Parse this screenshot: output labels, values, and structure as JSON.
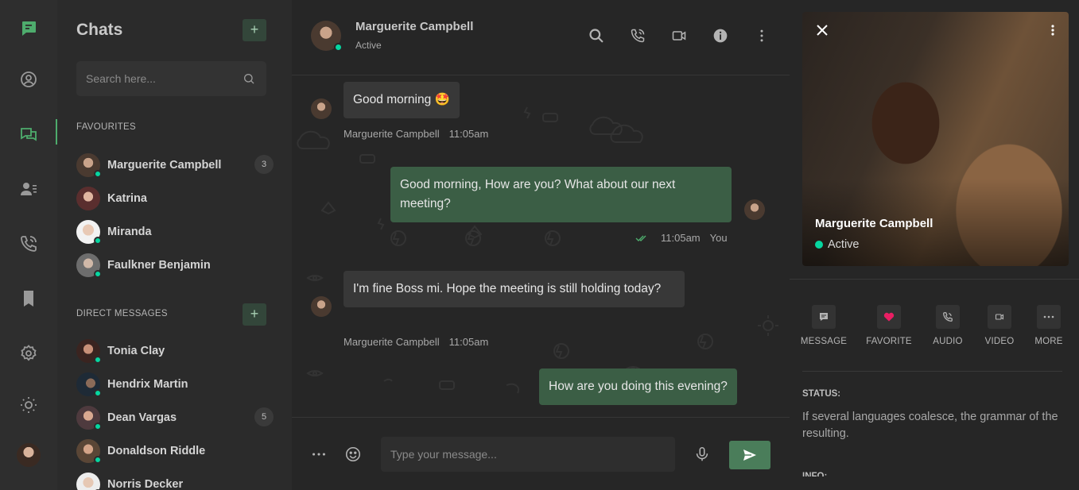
{
  "colors": {
    "accent": "#4eac6d",
    "online": "#06d6a0",
    "favorite": "#e91e63"
  },
  "rail": {
    "items": [
      {
        "name": "logo",
        "icon": "chat-logo-icon"
      },
      {
        "name": "profile",
        "icon": "user-circle-icon"
      },
      {
        "name": "chats",
        "icon": "chats-icon",
        "active": true
      },
      {
        "name": "contacts",
        "icon": "contacts-icon"
      },
      {
        "name": "calls",
        "icon": "phone-call-icon"
      },
      {
        "name": "bookmarks",
        "icon": "bookmark-icon"
      },
      {
        "name": "settings",
        "icon": "gear-icon"
      },
      {
        "name": "theme",
        "icon": "sun-icon"
      }
    ]
  },
  "chatlist": {
    "title": "Chats",
    "search_placeholder": "Search here...",
    "favourites_label": "FAVOURITES",
    "direct_label": "DIRECT MESSAGES",
    "favourites": [
      {
        "name": "Marguerite Campbell",
        "badge": "3",
        "online": true
      },
      {
        "name": "Katrina",
        "online": false
      },
      {
        "name": "Miranda",
        "online": true
      },
      {
        "name": "Faulkner Benjamin",
        "online": true
      }
    ],
    "direct": [
      {
        "name": "Tonia Clay",
        "online": true
      },
      {
        "name": "Hendrix Martin",
        "online": true
      },
      {
        "name": "Dean Vargas",
        "badge": "5",
        "online": true
      },
      {
        "name": "Donaldson Riddle",
        "online": true
      },
      {
        "name": "Norris Decker",
        "online": true
      }
    ]
  },
  "conversation": {
    "contact_name": "Marguerite Campbell",
    "contact_status": "Active",
    "messages": [
      {
        "from": "in",
        "text": "Good morning 🤩",
        "sender": "Marguerite Campbell",
        "time": "11:05am"
      },
      {
        "from": "out",
        "text": "Good morning, How are you? What about our next meeting?",
        "sender": "You",
        "time": "11:05am"
      },
      {
        "from": "in",
        "text": "I'm fine Boss mi. Hope the meeting is still holding today?",
        "sender": "Marguerite Campbell",
        "time": "11:05am"
      },
      {
        "from": "out",
        "text": "How are you doing this evening?"
      }
    ],
    "input_placeholder": "Type your message..."
  },
  "profile": {
    "name": "Marguerite Campbell",
    "status": "Active",
    "actions": [
      {
        "label": "MESSAGE",
        "icon": "message-icon"
      },
      {
        "label": "FAVORITE",
        "icon": "heart-icon"
      },
      {
        "label": "AUDIO",
        "icon": "phone-icon"
      },
      {
        "label": "VIDEO",
        "icon": "video-icon"
      },
      {
        "label": "MORE",
        "icon": "more-horizontal-icon"
      }
    ],
    "status_heading": "STATUS:",
    "status_text": "If several languages coalesce, the grammar of the resulting.",
    "info_heading": "INFO:"
  }
}
